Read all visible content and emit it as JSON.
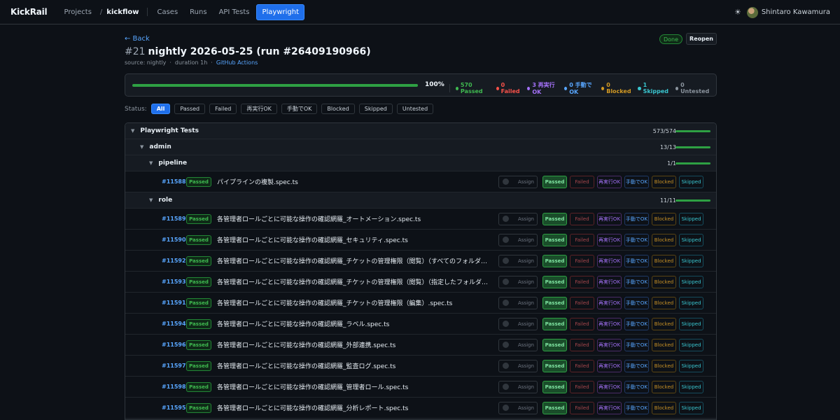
{
  "nav": {
    "logo": "KickRail",
    "projects": "Projects",
    "sep": "/",
    "project": "kickflow",
    "tabs": [
      {
        "label": "Cases",
        "active": false
      },
      {
        "label": "Runs",
        "active": false
      },
      {
        "label": "API Tests",
        "active": false
      },
      {
        "label": "Playwright",
        "active": true
      }
    ],
    "theme_icon": "☀",
    "user": "Shintaro Kawamura"
  },
  "header": {
    "back": "← Back",
    "run_number": "#21",
    "title": "nightly 2026-05-25 (run #26409190966)",
    "source": "source: nightly",
    "duration": "duration 1h",
    "link": "GitHub Actions",
    "done_badge": "Done",
    "reopen": "Reopen"
  },
  "summary": {
    "progress": 100,
    "percent_label": "100%",
    "stats": [
      {
        "label": "570 Passed",
        "color": "#3fb950"
      },
      {
        "label": "0 Failed",
        "color": "#f85149"
      },
      {
        "label": "3 再実行OK",
        "color": "#a371f7"
      },
      {
        "label": "0 手動でOK",
        "color": "#58a6ff"
      },
      {
        "label": "0 Blocked",
        "color": "#d29922"
      },
      {
        "label": "1 Skipped",
        "color": "#39c5cf"
      },
      {
        "label": "0 Untested",
        "color": "#8b949e"
      }
    ]
  },
  "filters": {
    "label": "Status:",
    "options": [
      {
        "label": "All",
        "active": true
      },
      {
        "label": "Passed",
        "active": false
      },
      {
        "label": "Failed",
        "active": false
      },
      {
        "label": "再実行OK",
        "active": false
      },
      {
        "label": "手動でOK",
        "active": false
      },
      {
        "label": "Blocked",
        "active": false
      },
      {
        "label": "Skipped",
        "active": false
      },
      {
        "label": "Untested",
        "active": false
      }
    ]
  },
  "action_labels": {
    "assign": "Assign",
    "passed": "Passed",
    "failed": "Failed",
    "retry": "再実行OK",
    "manual": "手動でOK",
    "blocked": "Blocked",
    "skipped": "Skipped"
  },
  "tree": [
    {
      "type": "group",
      "level": 0,
      "name": "Playwright Tests",
      "count": "573/574"
    },
    {
      "type": "group",
      "level": 1,
      "name": "admin",
      "count": "13/13"
    },
    {
      "type": "group",
      "level": 2,
      "name": "pipeline",
      "count": "1/1"
    },
    {
      "type": "case",
      "id": "#11588",
      "status": "Passed",
      "name": "パイプラインの複製.spec.ts"
    },
    {
      "type": "group",
      "level": 2,
      "name": "role",
      "count": "11/11"
    },
    {
      "type": "case",
      "id": "#11589",
      "status": "Passed",
      "name": "各管理者ロールごとに可能な操作の確認網羅_オートメーション.spec.ts"
    },
    {
      "type": "case",
      "id": "#11590",
      "status": "Passed",
      "name": "各管理者ロールごとに可能な操作の確認網羅_セキュリティ.spec.ts"
    },
    {
      "type": "case",
      "id": "#11592",
      "status": "Passed",
      "name": "各管理者ロールごとに可能な操作の確認網羅_チケットの管理権限（閲覧）（すべてのフォルダ）.spec.ts"
    },
    {
      "type": "case",
      "id": "#11593",
      "status": "Passed",
      "name": "各管理者ロールごとに可能な操作の確認網羅_チケットの管理権限（閲覧）（指定したフォルダのみ）.spec.ts"
    },
    {
      "type": "case",
      "id": "#11591",
      "status": "Passed",
      "name": "各管理者ロールごとに可能な操作の確認網羅_チケットの管理権限（編集）.spec.ts"
    },
    {
      "type": "case",
      "id": "#11594",
      "status": "Passed",
      "name": "各管理者ロールごとに可能な操作の確認網羅_ラベル.spec.ts"
    },
    {
      "type": "case",
      "id": "#11596",
      "status": "Passed",
      "name": "各管理者ロールごとに可能な操作の確認網羅_外部連携.spec.ts"
    },
    {
      "type": "case",
      "id": "#11597",
      "status": "Passed",
      "name": "各管理者ロールごとに可能な操作の確認網羅_監査ログ.spec.ts"
    },
    {
      "type": "case",
      "id": "#11598",
      "status": "Passed",
      "name": "各管理者ロールごとに可能な操作の確認網羅_管理者ロール.spec.ts"
    },
    {
      "type": "case",
      "id": "#11595",
      "status": "Passed",
      "name": "各管理者ロールごとに可能な操作の確認網羅_分析レポート.spec.ts"
    }
  ]
}
